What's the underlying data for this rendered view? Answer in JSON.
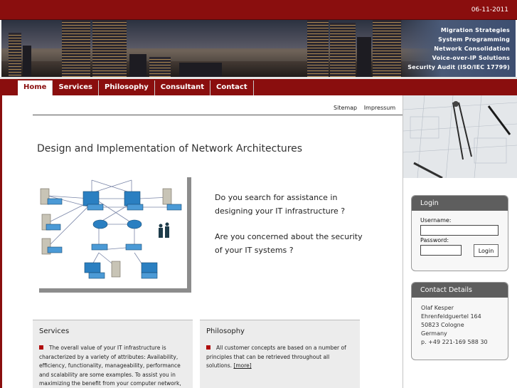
{
  "header": {
    "date": "06-11-2011"
  },
  "banner": {
    "items": [
      "Migration Strategies",
      "System Programming",
      "Network Consolidation",
      "Voice-over-IP Solutions",
      "Security Audit (ISO/IEC 17799)"
    ]
  },
  "nav": {
    "items": [
      {
        "label": "Home",
        "active": true
      },
      {
        "label": "Services",
        "active": false
      },
      {
        "label": "Philosophy",
        "active": false
      },
      {
        "label": "Consultant",
        "active": false
      },
      {
        "label": "Contact",
        "active": false
      }
    ]
  },
  "utility": {
    "sitemap": "Sitemap",
    "impressum": "Impressum"
  },
  "main": {
    "headline": "Design and Implementation of Network Architectures",
    "question1_line1": "Do you search for assistance in",
    "question1_line2": "designing your IT infrastructure ?",
    "question2_line1": "Are you concerned about the security",
    "question2_line2": "of your IT systems ?"
  },
  "boxes": {
    "services": {
      "title": "Services",
      "text": "The overall value of your IT infrastructure is characterized by a variety of attributes: Availability, efficiency, functionality, manageability, performance and scalability are some examples. To assist you in maximizing the benefit from your computer network,"
    },
    "philosophy": {
      "title": "Philosophy",
      "text": "All customer concepts are based on a number of principles that can be retrieved throughout all solutions.",
      "more": "[more]"
    }
  },
  "login": {
    "title": "Login",
    "username_label": "Username:",
    "password_label": "Password:",
    "username_value": "",
    "password_value": "",
    "button": "Login"
  },
  "contact": {
    "title": "Contact Details",
    "name": "Olaf Kesper",
    "street": "Ehrenfeldguertel 164",
    "city": "50823 Cologne",
    "country": "Germany",
    "phone": "p. +49 221-169 588 30"
  },
  "colors": {
    "brand": "#8a0e0e",
    "panel_header": "#5e5e5e",
    "box_bg": "#ececec",
    "bullet": "#b00d0d"
  }
}
